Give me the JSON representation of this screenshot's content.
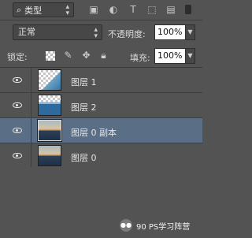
{
  "filter": {
    "kind_label": "类型",
    "icons": [
      "image-filter-icon",
      "adjustment-filter-icon",
      "type-filter-icon",
      "shape-filter-icon",
      "smart-object-filter-icon"
    ]
  },
  "blend": {
    "mode": "正常",
    "opacity_label": "不透明度:",
    "opacity_value": "100%"
  },
  "lock": {
    "label": "锁定:",
    "fill_label": "填充:",
    "fill_value": "100%"
  },
  "layers": [
    {
      "name": "图层 1",
      "selected": false,
      "visible": true
    },
    {
      "name": "图层 2",
      "selected": false,
      "visible": true
    },
    {
      "name": "图层 0 副本",
      "selected": true,
      "visible": true
    },
    {
      "name": "图层 0",
      "selected": false,
      "visible": true
    }
  ],
  "watermark": {
    "text": "90 PS学习阵营"
  },
  "colors": {
    "panel_bg": "#535353",
    "selected_row": "#5a6e86"
  }
}
